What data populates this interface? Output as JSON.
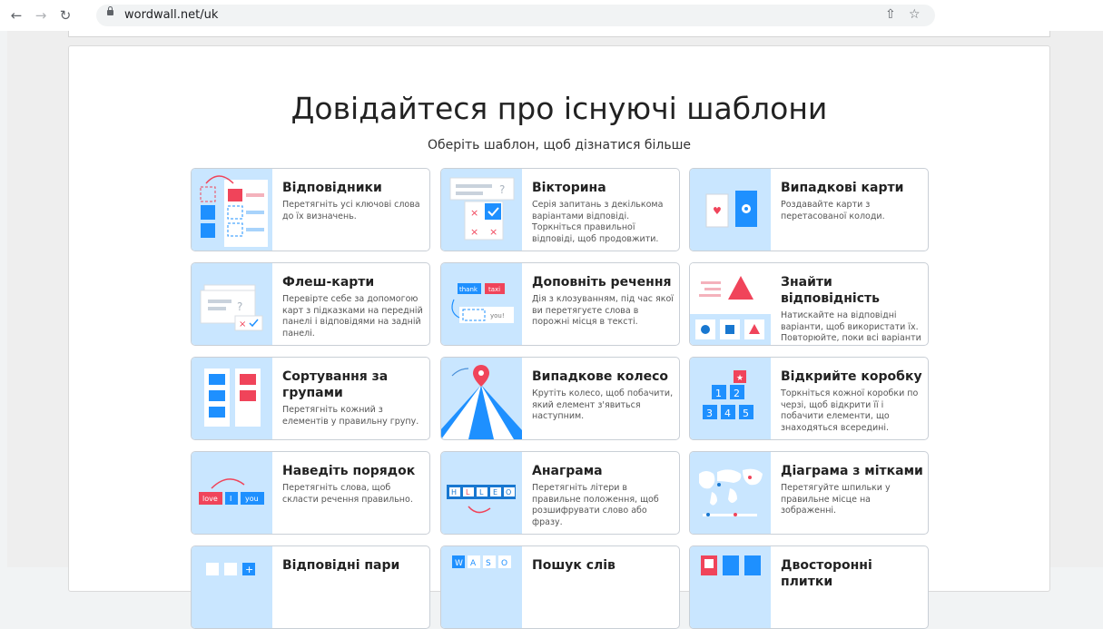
{
  "browser": {
    "url": "wordwall.net/uk"
  },
  "page": {
    "title": "Довідайтеся про існуючі шаблони",
    "subtitle": "Оберіть шаблон, щоб дізнатися більше"
  },
  "templates": [
    {
      "name": "Відповідники",
      "desc": "Перетягніть усі ключові слова до їх визначень."
    },
    {
      "name": "Вікторина",
      "desc": "Серія запитань з декількома варіантами відповіді. Торкніться правильної відповіді, щоб продовжити."
    },
    {
      "name": "Випадкові карти",
      "desc": "Роздавайте карти з перетасованої колоди."
    },
    {
      "name": "Флеш-карти",
      "desc": "Перевірте себе за допомогою карт з підказками на передній панелі і відповідями на задній панелі."
    },
    {
      "name": "Доповніть речення",
      "desc": "Дія з клозуванням, під час якої ви перетягуєте слова в порожні місця в тексті."
    },
    {
      "name": "Знайти відповідність",
      "desc": "Натискайте на відповідні варіанти, щоб використати їх. Повторюйте, поки всі варіанти"
    },
    {
      "name": "Сортування за групами",
      "desc": "Перетягніть кожний з елементів у правильну групу."
    },
    {
      "name": "Випадкове колесо",
      "desc": "Крутіть колесо, щоб побачити, який елемент з'явиться наступним."
    },
    {
      "name": "Відкрийте коробку",
      "desc": "Торкніться кожної коробки по черзі, щоб відкрити її і побачити елементи, що знаходяться всередині."
    },
    {
      "name": "Наведіть порядок",
      "desc": "Перетягніть слова, щоб скласти речення правильно."
    },
    {
      "name": "Анаграма",
      "desc": "Перетягніть літери в правильне положення, щоб розшифрувати слово або фразу."
    },
    {
      "name": "Діаграма з мітками",
      "desc": "Перетягуйте шпильки у правильне місце на зображенні."
    },
    {
      "name": "Відповідні пари",
      "desc": ""
    },
    {
      "name": "Пошук слів",
      "desc": ""
    },
    {
      "name": "Двосторонні плитки",
      "desc": ""
    }
  ],
  "thumb_text": {
    "thank": "thank",
    "taxi": "taxi",
    "you_excl": "you!",
    "love": "love",
    "i": "I",
    "you": "you",
    "anagram": [
      "H",
      "L",
      "L",
      "E",
      "O"
    ],
    "boxes": [
      "1",
      "2",
      "3",
      "4",
      "5"
    ],
    "wordsearch": [
      "W",
      "A",
      "S",
      "O"
    ]
  },
  "colors": {
    "thumb_bg": "#c9e6ff",
    "blue": "#1e90ff",
    "red": "#f0445a",
    "dark_blue": "#1877d0"
  }
}
